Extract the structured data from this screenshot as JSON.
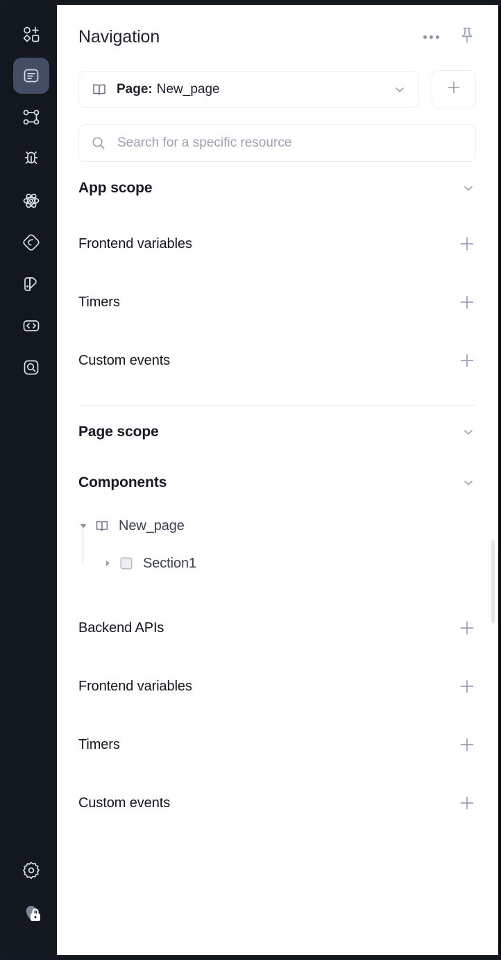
{
  "rail": {
    "items": [
      {
        "name": "add-component-icon",
        "label": "Add component"
      },
      {
        "name": "navigation-icon",
        "label": "Navigation",
        "active": true
      },
      {
        "name": "workflows-icon",
        "label": "Workflows"
      },
      {
        "name": "debugger-icon",
        "label": "Debugger"
      },
      {
        "name": "state-icon",
        "label": "State"
      },
      {
        "name": "data-sources-icon",
        "label": "Data sources"
      },
      {
        "name": "theme-icon",
        "label": "Theme"
      },
      {
        "name": "code-icon",
        "label": "Code"
      },
      {
        "name": "inspect-icon",
        "label": "Inspect"
      }
    ],
    "bottom": [
      {
        "name": "settings-gear-icon",
        "label": "Settings"
      },
      {
        "name": "account-lock-avatar",
        "label": "Account"
      }
    ]
  },
  "header": {
    "title": "Navigation",
    "more_label": "More options",
    "pin_label": "Pin panel"
  },
  "page_selector": {
    "icon": "book-icon",
    "label": "Page:",
    "value": "New_page",
    "chevron": "chevron-down-icon",
    "add_label": "+"
  },
  "search": {
    "placeholder": "Search for a specific resource",
    "value": "",
    "icon": "search-icon"
  },
  "app_scope": {
    "title": "App scope",
    "expanded": true,
    "items": [
      {
        "label": "Frontend variables",
        "action": "+"
      },
      {
        "label": "Timers",
        "action": "+"
      },
      {
        "label": "Custom events",
        "action": "+"
      }
    ]
  },
  "page_scope": {
    "title": "Page scope",
    "expanded": true,
    "components": {
      "title": "Components",
      "expanded": true,
      "tree": [
        {
          "label": "New_page",
          "icon": "book-icon",
          "expanded": true,
          "depth": 0
        },
        {
          "label": "Section1",
          "icon": "section-square-icon",
          "expanded": false,
          "depth": 1
        }
      ]
    },
    "items": [
      {
        "label": "Backend APIs",
        "action": "+"
      },
      {
        "label": "Frontend variables",
        "action": "+"
      },
      {
        "label": "Timers",
        "action": "+"
      },
      {
        "label": "Custom events",
        "action": "+"
      }
    ]
  },
  "colors": {
    "rail_bg": "#13171e",
    "rail_active": "#454d64",
    "panel_bg": "#ffffff",
    "text_primary": "#1e2230",
    "text_muted": "#9aa0b1",
    "border": "#eceef2",
    "tree_text": "#3a4152"
  }
}
